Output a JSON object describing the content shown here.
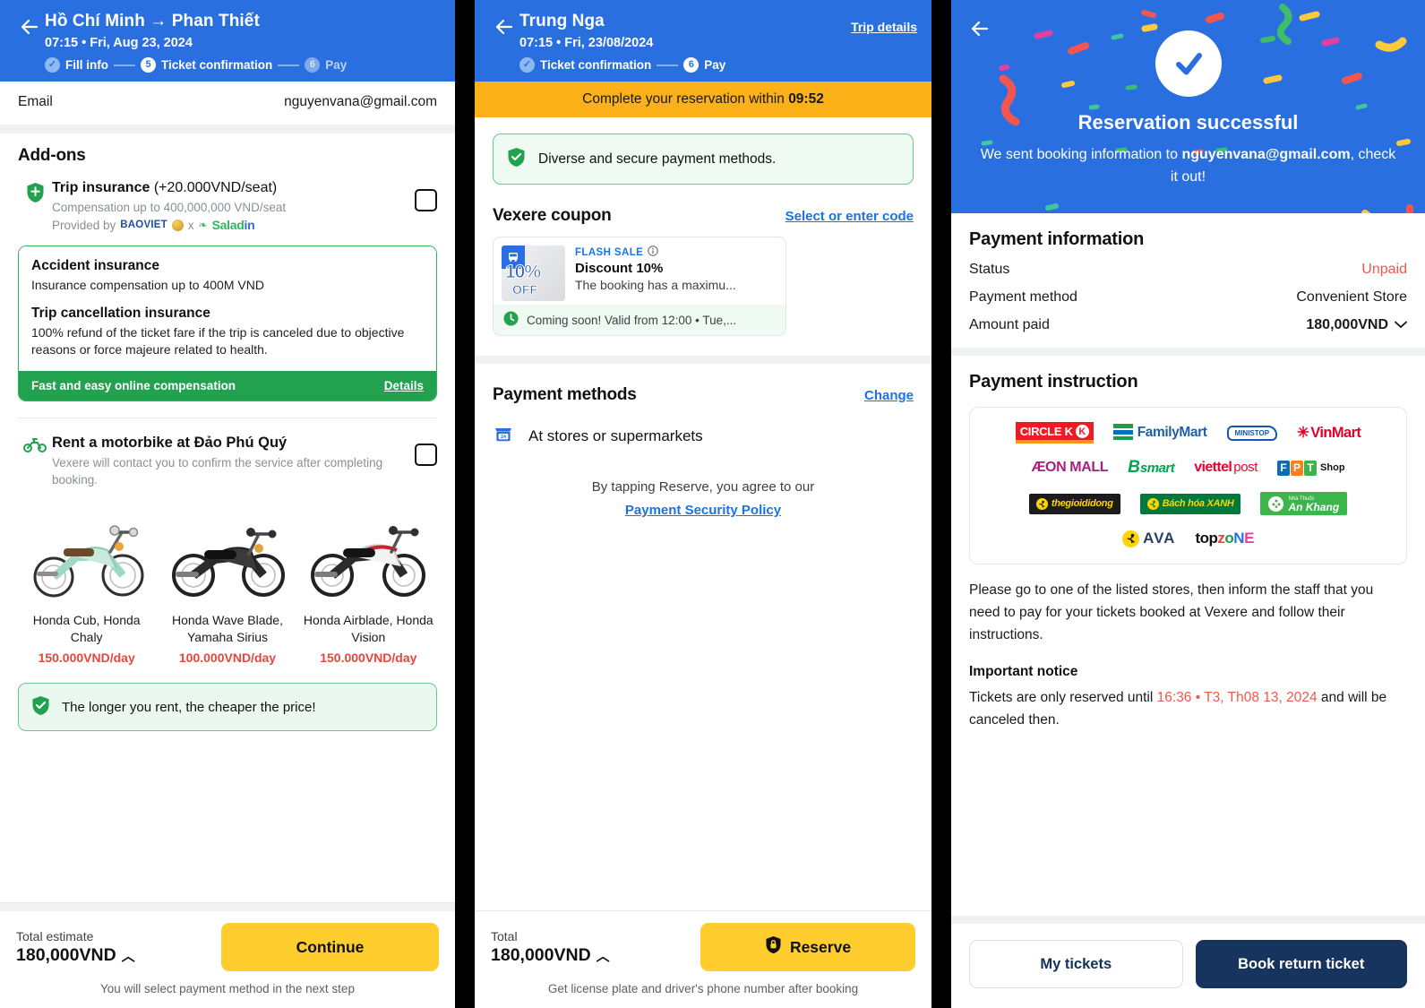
{
  "panel1": {
    "header": {
      "back_icon": "back-arrow-icon",
      "title": "Hồ Chí Minh → Phan Thiết",
      "subtitle": "07:15 • Fri, Aug 23, 2024",
      "steps": [
        {
          "badge": "✓",
          "label": "Fill info",
          "state": "done"
        },
        {
          "badge": "5",
          "label": "Ticket confirmation",
          "state": "active"
        },
        {
          "badge": "6",
          "label": "Pay",
          "state": "todo"
        }
      ]
    },
    "email_row": {
      "label": "Email",
      "value": "nguyenvana@gmail.com"
    },
    "addons_title": "Add-ons",
    "trip_insurance": {
      "icon": "shield-icon",
      "title": "Trip insurance",
      "price_suffix": "(+20.000VND/seat)",
      "compensation": "Compensation up to 400,000,000 VND/seat",
      "provided_by_label": "Provided by",
      "provider_1": "BAOVIET",
      "provider_sep": "x",
      "provider_2": "Saladin",
      "checkbox_checked": false
    },
    "insurance_card": {
      "accident_title": "Accident insurance",
      "accident_desc": "Insurance compensation up to 400M VND",
      "cancel_title": "Trip cancellation insurance",
      "cancel_desc": "100% refund of the ticket fare if the trip is canceled due to objective reasons or force majeure related to health.",
      "footer_text": "Fast and easy online compensation",
      "footer_link": "Details"
    },
    "motorbike": {
      "icon": "motorbike-icon",
      "title": "Rent a motorbike at Đảo Phú Quý",
      "desc": "Vexere will contact you to confirm the service after completing booking.",
      "checkbox_checked": false,
      "options": [
        {
          "name": "Honda Cub, Honda Chaly",
          "price": "150.000VND/day"
        },
        {
          "name": "Honda Wave Blade, Yamaha Sirius",
          "price": "100.000VND/day"
        },
        {
          "name": "Honda Airblade, Honda Vision",
          "price": "150.000VND/day"
        }
      ]
    },
    "tip": {
      "icon": "shield-check-icon",
      "text": "The longer you rent, the cheaper the price!"
    },
    "footer": {
      "total_label": "Total estimate",
      "total_value": "180,000VND",
      "caret": "chevron-up-icon",
      "button": "Continue",
      "note": "You will select payment method in the next step"
    }
  },
  "panel2": {
    "header": {
      "back_icon": "back-arrow-icon",
      "title": "Trung Nga",
      "subtitle": "07:15 • Fri, 23/08/2024",
      "trip_details_link": "Trip details",
      "steps": [
        {
          "badge": "✓",
          "label": "Ticket confirmation",
          "state": "done"
        },
        {
          "badge": "6",
          "label": "Pay",
          "state": "active"
        }
      ]
    },
    "timer": {
      "prefix": "Complete your reservation within",
      "value": "09:52"
    },
    "notice": {
      "icon": "shield-check-icon",
      "text": "Diverse and secure payment methods."
    },
    "coupon_section": {
      "title": "Vexere coupon",
      "link": "Select or enter code"
    },
    "coupon": {
      "thumb_percent": "10%",
      "thumb_off": "OFF",
      "thumb_icon": "bus-icon",
      "tag": "FLASH SALE",
      "tag_icon": "info-icon",
      "title": "Discount 10%",
      "desc": "The booking has a maximu...",
      "footer_icon": "clock-icon",
      "footer": "Coming soon! Valid from 12:00 • Tue,..."
    },
    "payment_section": {
      "title": "Payment methods",
      "link": "Change"
    },
    "payment_method": {
      "icon": "store-icon",
      "label": "At stores or supermarkets"
    },
    "agree": {
      "text": "By tapping Reserve, you agree to our",
      "link": "Payment Security Policy"
    },
    "footer": {
      "total_label": "Total",
      "total_value": "180,000VND",
      "caret": "chevron-up-icon",
      "button": "Reserve",
      "button_icon": "lock-shield-icon",
      "note": "Get license plate and driver's phone number after booking"
    }
  },
  "panel3": {
    "header": {
      "back_icon": "back-arrow-icon",
      "check_icon": "check-circle-icon",
      "title": "Reservation successful",
      "sub_prefix": "We sent booking information to",
      "sub_email": "nguyenvana@gmail.com",
      "sub_suffix": ", check it out!"
    },
    "payment_information": {
      "title": "Payment information",
      "rows": [
        {
          "label": "Status",
          "value": "Unpaid",
          "style": "red"
        },
        {
          "label": "Payment method",
          "value": "Convenient Store",
          "style": "plain"
        },
        {
          "label": "Amount paid",
          "value": "180,000VND",
          "style": "bold",
          "caret": "chevron-down-icon"
        }
      ]
    },
    "payment_instruction": {
      "title": "Payment instruction",
      "stores_row1": [
        "CIRCLE K",
        "FamilyMart",
        "MINI STOP",
        "VinMart"
      ],
      "stores_row2": [
        "ÆON MALL",
        "B'smart",
        "viettel post",
        "FPT Shop"
      ],
      "stores_row3": [
        "thegioididong",
        "Bách hóa XANH",
        "An Khang"
      ],
      "stores_row4": [
        "AVA",
        "topzone"
      ],
      "paragraph": "Please go to one of the listed stores, then inform the staff that you need to pay for your tickets booked at Vexere and follow their instructions.",
      "notice_title": "Important notice",
      "notice_prefix": "Tickets are only reserved until",
      "notice_time": "16:36 • T3, Th08 13, 2024",
      "notice_suffix": "and will be canceled then."
    },
    "footer": {
      "my_tickets": "My tickets",
      "book_return": "Book return ticket"
    }
  },
  "colors": {
    "brand_blue": "#2a6fe0",
    "yellow": "#ffcd2e",
    "green": "#22a24f",
    "red": "#f2574c",
    "navy": "#16345e",
    "amber": "#fbb117"
  }
}
